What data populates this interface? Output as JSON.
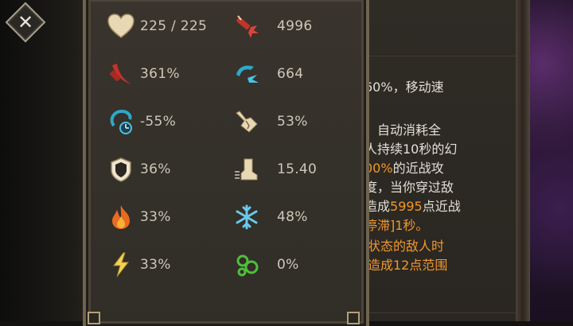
{
  "stats": [
    {
      "icon": "heart-icon",
      "value": "225 / 225"
    },
    {
      "icon": "dynamite-icon",
      "value": "4996"
    },
    {
      "icon": "red-slash-icon",
      "value": "361%"
    },
    {
      "icon": "blue-claw-icon",
      "value": "664"
    },
    {
      "icon": "cooldown-icon",
      "value": "-55%"
    },
    {
      "icon": "broken-arm-icon",
      "value": "53%"
    },
    {
      "icon": "shield-icon",
      "value": "36%"
    },
    {
      "icon": "boot-speed-icon",
      "value": "15.40"
    },
    {
      "icon": "fire-icon",
      "value": "33%"
    },
    {
      "icon": "snowflake-icon",
      "value": "48%"
    },
    {
      "icon": "lightning-icon",
      "value": "33%"
    },
    {
      "icon": "poison-bubbles-icon",
      "value": "0%"
    }
  ],
  "description": {
    "line1": "60%，移动速",
    "line2": "：自动消耗全",
    "line3": "人持续10秒的幻",
    "line4a": "00%",
    "line4b": "的近战攻",
    "line5": "度，当你穿过敌",
    "line6a": "造成",
    "line6b": "5995",
    "line6c": "点近战",
    "line7": "停滞]1秒。",
    "line8": "状态的敌人时",
    "line9": "造成12点范围"
  },
  "colors": {
    "panel_bg": "#36312b",
    "stat_text": "#cfc8b8",
    "highlight": "#f0982e",
    "frame": "#6e644f"
  }
}
